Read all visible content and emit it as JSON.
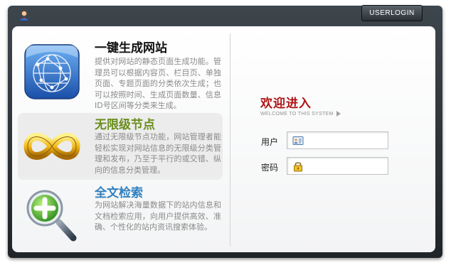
{
  "header": {
    "userlogin_label": "USERLOGIN"
  },
  "features": [
    {
      "title": "一键生成网站",
      "title_color": "#111111",
      "desc": "提供对网站的静态页面生成功能。管理员可以根据内容页、栏目页、单独页面、专题页面的分类依次生成；也可以按照时间、生成页面数量、信息ID号区间等分类来生成。",
      "icon": "network-globe-icon"
    },
    {
      "title": "无限级节点",
      "title_color": "#6a8e1e",
      "desc": "通过无限级节点功能，网站管理者能轻松实现对网站信息的无限级分类管理和发布，乃至于平行的或交错、纵向的信息分类管理。",
      "icon": "infinity-icon"
    },
    {
      "title": "全文检索",
      "title_color": "#2f7fc0",
      "desc": "为网站解决海量数据下的站内信息和文档检索应用，向用户提供高效、准确、个性化的站内资讯搜索体验。",
      "icon": "magnifier-plus-icon"
    }
  ],
  "login": {
    "title": "欢迎进入",
    "subtitle": "WELCOME TO THIS SYSTEM",
    "username_label": "用户",
    "password_label": "密码",
    "username_value": "",
    "password_value": ""
  },
  "colors": {
    "frame": "#2b3137",
    "accent_red": "#b01414"
  }
}
